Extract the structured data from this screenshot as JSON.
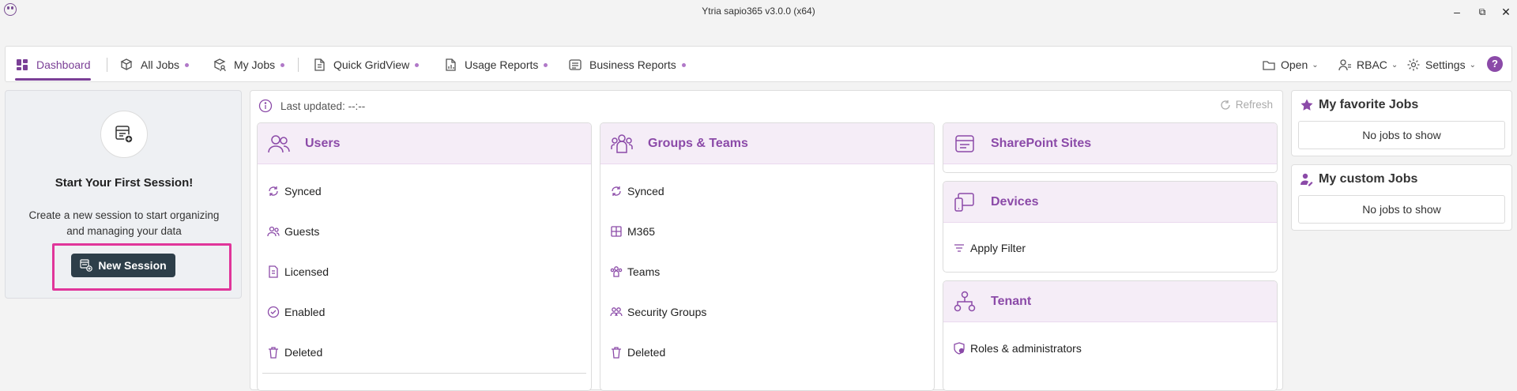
{
  "app": {
    "title": "Ytria sapio365 v3.0.0 (x64)"
  },
  "window_controls": {
    "minimize": "–",
    "restore": "⧉",
    "close": "✕"
  },
  "nav": {
    "tabs": [
      {
        "label": "Dashboard",
        "icon": "dashboard-icon",
        "active": true
      },
      {
        "label": "All Jobs",
        "icon": "all-jobs-icon",
        "dot": true
      },
      {
        "label": "My Jobs",
        "icon": "my-jobs-icon",
        "dot": true
      },
      {
        "label": "Quick GridView",
        "icon": "quick-gridview-icon",
        "dot": true
      },
      {
        "label": "Usage Reports",
        "icon": "usage-reports-icon",
        "dot": true
      },
      {
        "label": "Business Reports",
        "icon": "business-reports-icon",
        "dot": true
      }
    ],
    "right": {
      "open": "Open",
      "rbac": "RBAC",
      "settings": "Settings",
      "help": "?"
    }
  },
  "session": {
    "title": "Start Your First Session!",
    "description": "Create a new session to start organizing and managing your data",
    "button": "New Session"
  },
  "status": {
    "last_updated": "Last updated: --:--",
    "refresh": "Refresh"
  },
  "cards": {
    "users": {
      "title": "Users",
      "items": [
        "Synced",
        "Guests",
        "Licensed",
        "Enabled",
        "Deleted"
      ]
    },
    "groups": {
      "title": "Groups & Teams",
      "items": [
        "Synced",
        "M365",
        "Teams",
        "Security Groups",
        "Deleted"
      ]
    },
    "sharepoint": {
      "title": "SharePoint Sites"
    },
    "devices": {
      "title": "Devices",
      "items": [
        "Apply Filter"
      ]
    },
    "tenant": {
      "title": "Tenant",
      "items": [
        "Roles & administrators"
      ]
    }
  },
  "favorites": {
    "title": "My favorite Jobs",
    "empty": "No jobs to show"
  },
  "custom_jobs": {
    "title": "My custom Jobs",
    "empty": "No jobs to show"
  },
  "colors": {
    "accent": "#8b4aa8",
    "button_dark": "#2d3e49",
    "highlight": "#e0359a",
    "card_header": "#f5edf7"
  }
}
